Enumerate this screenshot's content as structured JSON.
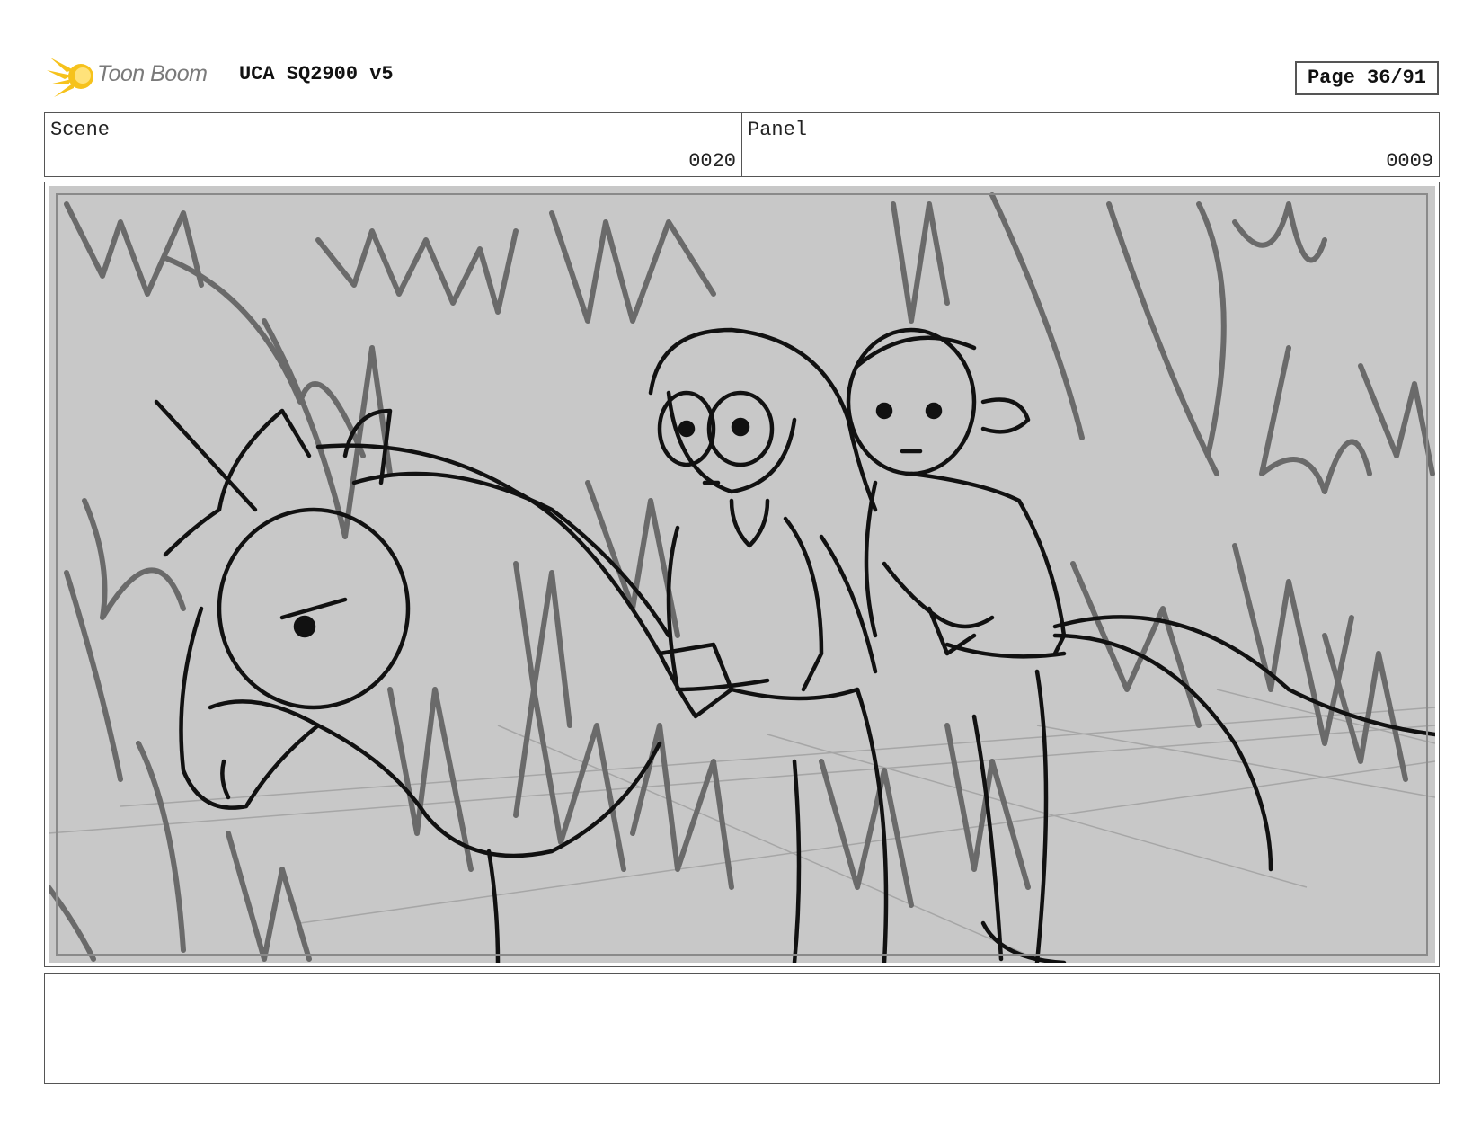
{
  "header": {
    "brand_name": "Toon Boom",
    "document_title": "UCA SQ2900 v5",
    "page_indicator": "Page 36/91"
  },
  "info": {
    "scene_label": "Scene",
    "scene_value": "0020",
    "panel_label": "Panel",
    "panel_value": "0009"
  },
  "panel": {
    "art_icon": "storyboard-sketch-two-riders-on-horse-in-forest"
  },
  "notes": {
    "text": ""
  },
  "colors": {
    "logo_yellow": "#f6c21c",
    "sketch_bg": "#c8c8c8",
    "sketch_dark": "#111111",
    "sketch_mid": "#6a6a6a"
  }
}
